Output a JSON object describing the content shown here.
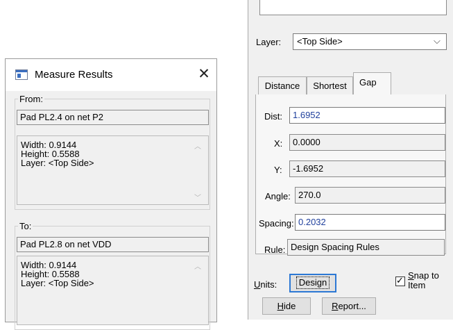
{
  "measure_dialog": {
    "title": "Measure Results",
    "from": {
      "label": "From:",
      "item": "Pad PL2.4 on net P2",
      "details": [
        "Width:  0.9144",
        "Height: 0.5588",
        "Layer:  <Top Side>"
      ]
    },
    "to": {
      "label": "To:",
      "item": "Pad PL2.8 on net VDD",
      "details": [
        "Width:  0.9144",
        "Height: 0.5588",
        "Layer:  <Top Side>"
      ]
    }
  },
  "measure_panel": {
    "layer_label": "Layer:",
    "layer_value": "<Top Side>",
    "tabs": [
      "Distance",
      "Shortest",
      "Gap"
    ],
    "active_tab": "Gap",
    "dist_label": "Dist:",
    "dist_value": "1.6952",
    "x_label": "X:",
    "x_value": "0.0000",
    "y_label": "Y:",
    "y_value": "-1.6952",
    "angle_label": "Angle:",
    "angle_value": "270.0",
    "spacing_label": "Spacing:",
    "spacing_value": "0.2032",
    "rule_label": "Rule:",
    "rule_value": "Design Spacing Rules",
    "units_label_pre": "",
    "units_label_u": "U",
    "units_label_post": "nits:",
    "units_value": "Design",
    "snap_label_u": "S",
    "snap_label_line1_post": "nap to",
    "snap_label_line2": "Item",
    "snap_checked": true,
    "hide_u": "H",
    "hide_post": "ide",
    "report_u": "R",
    "report_post": "eport..."
  }
}
